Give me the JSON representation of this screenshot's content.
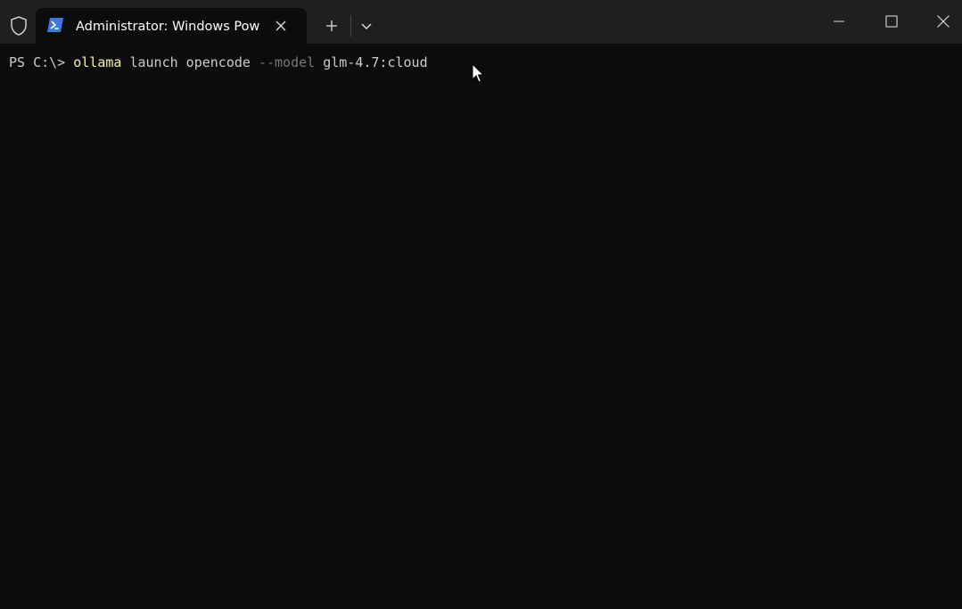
{
  "window": {
    "tab_title": "Administrator: Windows PowerShell",
    "shield_icon": "shield-icon",
    "tab_icon": "powershell-icon",
    "close_tab_icon": "close-icon",
    "new_tab_icon": "plus-icon",
    "dropdown_icon": "chevron-down-icon",
    "minimize_icon": "minimize-icon",
    "maximize_icon": "maximize-icon",
    "close_window_icon": "close-icon"
  },
  "terminal": {
    "prompt": "PS C:\\> ",
    "command": "ollama",
    "arg1": " launch opencode ",
    "flag": "--model",
    "arg2": " glm-4.7:cloud"
  },
  "colors": {
    "background": "#0c0c0e",
    "titlebar": "#1f1f1f",
    "command": "#f9f1a5",
    "flag": "#767676",
    "text": "#cccccc",
    "ps_icon": "#3b7ad8"
  }
}
